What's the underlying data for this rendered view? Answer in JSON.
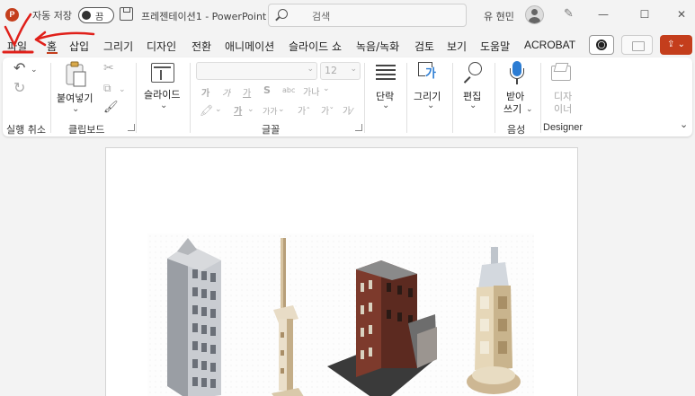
{
  "titlebar": {
    "app_logo": "P",
    "autosave_label": "자동 저장",
    "autosave_state": "끔",
    "doc_title": "프레젠테이션1  -  PowerPoint",
    "search_placeholder": "검색",
    "user_name": "유 현민",
    "minimize": "—",
    "maximize": "☐",
    "close": "✕"
  },
  "tabs": [
    "파일",
    "홈",
    "삽입",
    "그리기",
    "디자인",
    "전환",
    "애니메이션",
    "슬라이드 쇼",
    "녹음/녹화",
    "검토",
    "보기",
    "도움말",
    "ACROBAT"
  ],
  "ribbon": {
    "undo_group": "실행 취소",
    "clipboard": {
      "paste": "붙여넣기",
      "group": "클립보드"
    },
    "slides": {
      "new_slide": "슬라이드"
    },
    "font": {
      "size": "12",
      "group": "글꼴",
      "bold": "가",
      "italic": "가",
      "underline": "가",
      "strike": "S",
      "spacing": "가나"
    },
    "paragraph": {
      "label": "단락"
    },
    "drawing": {
      "label": "그리기"
    },
    "editing": {
      "label": "편집"
    },
    "voice": {
      "dictate": "받아",
      "dictate2": "쓰기",
      "group": "음성"
    },
    "designer": {
      "label1": "디자",
      "label2": "이너",
      "group": "Designer"
    }
  },
  "colors": {
    "accent": "#c43e1c",
    "annotation": "#e0201a"
  }
}
